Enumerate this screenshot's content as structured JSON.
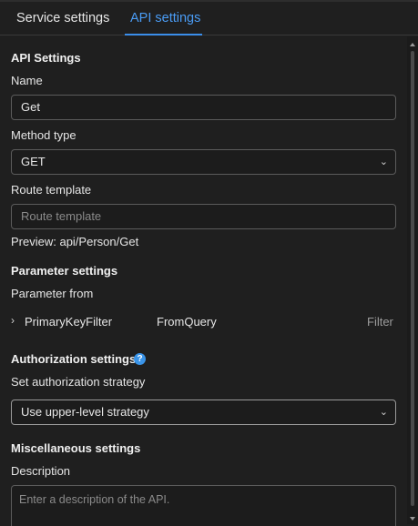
{
  "tabs": {
    "service_settings": "Service settings",
    "api_settings": "API settings"
  },
  "api_settings": {
    "heading": "API Settings",
    "name_label": "Name",
    "name_value": "Get",
    "method_label": "Method type",
    "method_value": "GET",
    "route_label": "Route template",
    "route_placeholder": "Route template",
    "preview": "Preview: api/Person/Get"
  },
  "parameter_settings": {
    "heading": "Parameter settings",
    "from_label": "Parameter from",
    "rows": [
      {
        "name": "PrimaryKeyFilter",
        "source": "FromQuery",
        "kind": "Filter"
      }
    ]
  },
  "authorization_settings": {
    "heading": "Authorization settings",
    "help_glyph": "?",
    "strategy_label": "Set authorization strategy",
    "strategy_value": "Use upper-level strategy"
  },
  "misc_settings": {
    "heading": "Miscellaneous settings",
    "description_label": "Description",
    "description_placeholder": "Enter a description of the API."
  },
  "icons": {
    "chevron_down": "⌄",
    "chevron_right": "›"
  },
  "colors": {
    "accent": "#3b8eea",
    "background": "#1f1f1f"
  }
}
